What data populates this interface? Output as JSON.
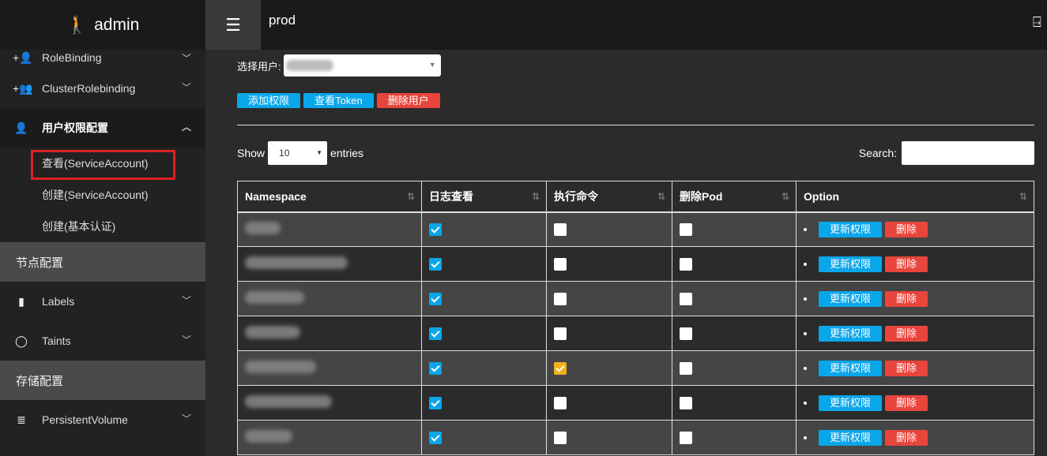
{
  "brand": {
    "title": "admin",
    "icon": "blind-person-icon"
  },
  "topbar": {
    "title": "prod",
    "menu_icon": "hamburger-icon",
    "logout_icon": "logout-icon"
  },
  "sidebar": {
    "items": [
      {
        "label": "RoleBinding",
        "icon": "user-plus-icon"
      },
      {
        "label": "ClusterRolebinding",
        "icon": "users-plus-icon"
      },
      {
        "label": "用户权限配置",
        "icon": "user-gear-icon"
      }
    ],
    "sub_items": [
      {
        "label": "查看(ServiceAccount)"
      },
      {
        "label": "创建(ServiceAccount)"
      },
      {
        "label": "创建(基本认证)"
      }
    ],
    "section1": "节点配置",
    "items2": [
      {
        "label": "Labels",
        "icon": "tag-icon"
      },
      {
        "label": "Taints",
        "icon": "circle-icon"
      }
    ],
    "section2": "存储配置",
    "items3": [
      {
        "label": "PersistentVolume",
        "icon": "database-icon"
      }
    ]
  },
  "main": {
    "select_label": "选择用户:",
    "buttons": {
      "add": "添加权限",
      "token": "查看Token",
      "delete": "删除用户"
    },
    "show_label": "Show",
    "entries_value": "10",
    "entries_label": "entries",
    "search_label": "Search:",
    "columns": [
      "Namespace",
      "日志查看",
      "执行命令",
      "删除Pod",
      "Option"
    ],
    "update_label": "更新权限",
    "delete_label": "删除",
    "rows": [
      {
        "log": true,
        "exec": false,
        "del": false,
        "exec_warn": false
      },
      {
        "log": true,
        "exec": false,
        "del": false,
        "exec_warn": false
      },
      {
        "log": true,
        "exec": false,
        "del": false,
        "exec_warn": false
      },
      {
        "log": true,
        "exec": false,
        "del": false,
        "exec_warn": false
      },
      {
        "log": true,
        "exec": true,
        "del": false,
        "exec_warn": true
      },
      {
        "log": true,
        "exec": false,
        "del": false,
        "exec_warn": false
      },
      {
        "log": true,
        "exec": false,
        "del": false,
        "exec_warn": false
      }
    ]
  },
  "colors": {
    "accent": "#0aa6ea",
    "danger": "#e8453c",
    "warning": "#f0b21a",
    "highlight": "#e02020"
  }
}
